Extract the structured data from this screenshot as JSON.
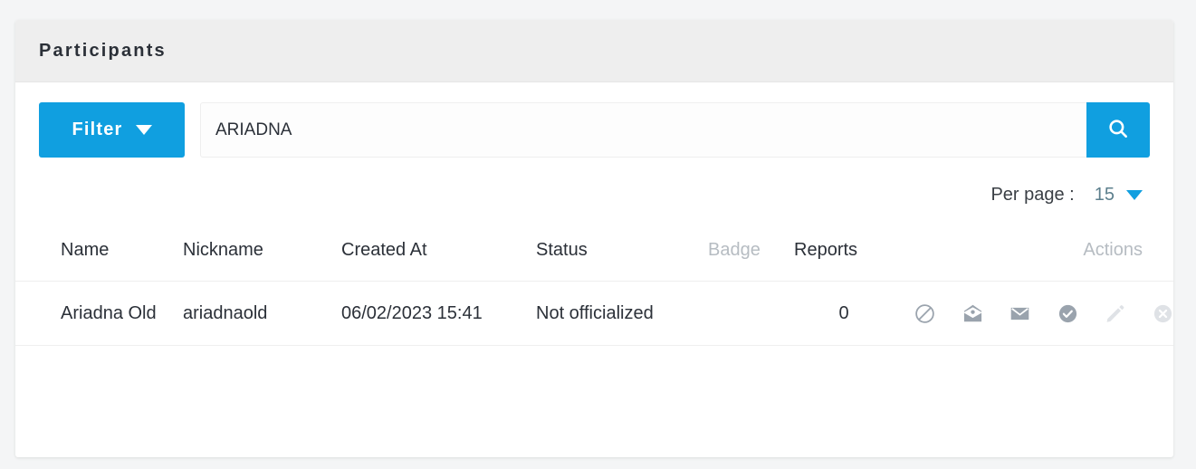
{
  "card": {
    "title": "Participants"
  },
  "toolbar": {
    "filter_label": "Filter",
    "filter_caret_icon": "chevron-down-icon",
    "search_value": "ARIADNA",
    "search_placeholder": "",
    "search_button_icon": "search-icon"
  },
  "pagination": {
    "per_page_label": "Per page :",
    "per_page_value": "15",
    "per_page_caret_icon": "chevron-down-icon",
    "options": [
      "15"
    ]
  },
  "table": {
    "columns": [
      {
        "key": "name",
        "label": "Name",
        "muted": false
      },
      {
        "key": "nickname",
        "label": "Nickname",
        "muted": false
      },
      {
        "key": "created_at",
        "label": "Created At",
        "muted": false
      },
      {
        "key": "status",
        "label": "Status",
        "muted": false
      },
      {
        "key": "badge",
        "label": "Badge",
        "muted": true
      },
      {
        "key": "reports",
        "label": "Reports",
        "muted": false
      },
      {
        "key": "actions",
        "label": "Actions",
        "muted": true
      }
    ],
    "rows": [
      {
        "name": "Ariadna Old",
        "nickname": "ariadnaold",
        "created_at": "06/02/2023 15:41",
        "status": "Not officialized",
        "badge": "",
        "reports": "0",
        "actions": [
          {
            "name": "block-icon",
            "enabled": true
          },
          {
            "name": "open-envelope-icon",
            "enabled": true
          },
          {
            "name": "envelope-icon",
            "enabled": true
          },
          {
            "name": "check-circle-icon",
            "enabled": true
          },
          {
            "name": "pencil-icon",
            "enabled": false
          },
          {
            "name": "close-circle-icon",
            "enabled": false
          }
        ]
      }
    ]
  },
  "colors": {
    "accent": "#109fe0",
    "header_bg": "#eeeeee",
    "page_bg": "#f4f5f6",
    "text": "#2b3038",
    "muted_text": "#b6bcc2",
    "icon_grey": "#9aa3ad",
    "icon_light": "#dfe2e6",
    "per_page_value": "#5c7f8d"
  }
}
